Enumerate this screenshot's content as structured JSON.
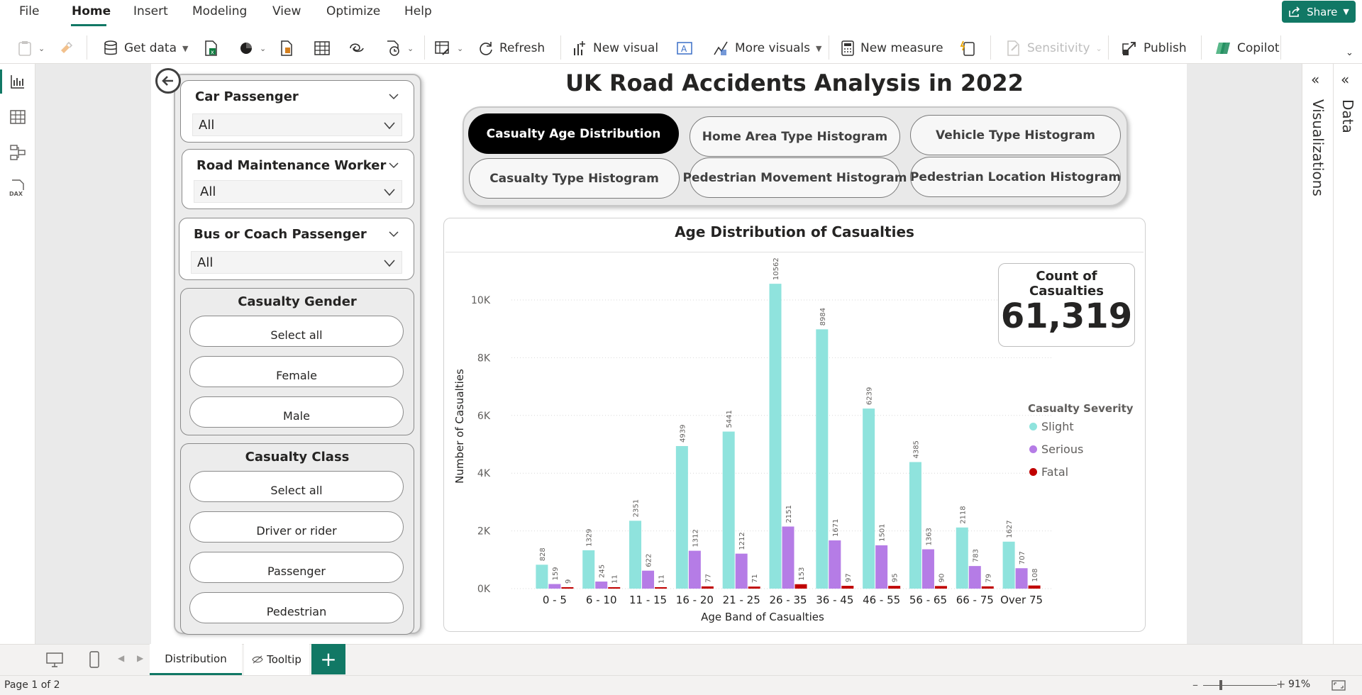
{
  "menu": {
    "items": [
      "File",
      "Home",
      "Insert",
      "Modeling",
      "View",
      "Optimize",
      "Help"
    ],
    "share_label": "Share"
  },
  "ribbon": {
    "get_data": "Get data",
    "refresh": "Refresh",
    "new_visual": "New visual",
    "more_visuals": "More visuals",
    "new_measure": "New measure",
    "sensitivity": "Sensitivity",
    "publish": "Publish",
    "copilot": "Copilot"
  },
  "slicers": {
    "dropdowns": [
      {
        "title": "Car Passenger",
        "value": "All"
      },
      {
        "title": "Road Maintenance Worker",
        "value": "All"
      },
      {
        "title": "Bus or Coach Passenger",
        "value": "All"
      }
    ],
    "gender": {
      "title": "Casualty Gender",
      "options": [
        "Select all",
        "Female",
        "Male"
      ]
    },
    "class": {
      "title": "Casualty Class",
      "options": [
        "Select all",
        "Driver or rider",
        "Passenger",
        "Pedestrian"
      ]
    }
  },
  "report": {
    "title": "UK Road Accidents Analysis in 2022",
    "tabs": [
      "Casualty Age Distribution",
      "Home Area Type Histogram",
      "Vehicle Type Histogram",
      "Casualty Type Histogram",
      "Pedestrian Movement Histogram",
      "Pedestrian Location Histogram"
    ],
    "active_tab": 0
  },
  "kpi": {
    "label": "Count of Casualties",
    "value": "61,319"
  },
  "legend": {
    "title": "Casualty Severity"
  },
  "chart_data": {
    "type": "bar",
    "title": "Age Distribution of Casualties",
    "xlabel": "Age Band of Casualties",
    "ylabel": "Number of Casualties",
    "categories": [
      "0 - 5",
      "6 - 10",
      "11 - 15",
      "16 - 20",
      "21 - 25",
      "26 - 35",
      "36 - 45",
      "46 - 55",
      "56 - 65",
      "66 - 75",
      "Over 75"
    ],
    "series": [
      {
        "name": "Slight",
        "color": "#8fe3dd",
        "values": [
          828,
          1329,
          2351,
          4939,
          5441,
          10562,
          8984,
          6239,
          4385,
          2118,
          1627
        ]
      },
      {
        "name": "Serious",
        "color": "#b57ce6",
        "values": [
          159,
          245,
          622,
          1312,
          1212,
          2151,
          1671,
          1501,
          1363,
          783,
          707
        ]
      },
      {
        "name": "Fatal",
        "color": "#c00000",
        "values": [
          9,
          11,
          11,
          77,
          71,
          153,
          97,
          95,
          90,
          79,
          108
        ]
      }
    ],
    "yticks": [
      "0K",
      "2K",
      "4K",
      "6K",
      "8K",
      "10K"
    ],
    "ylim": [
      0,
      11000
    ],
    "grid": true,
    "legend_position": "right"
  },
  "pages": {
    "tabs": [
      "Distribution",
      "Tooltip"
    ],
    "add_label": "+"
  },
  "status": {
    "page": "Page 1 of 2",
    "zoom": "91%"
  },
  "panes": {
    "visualizations": "Visualizations",
    "data": "Data"
  }
}
